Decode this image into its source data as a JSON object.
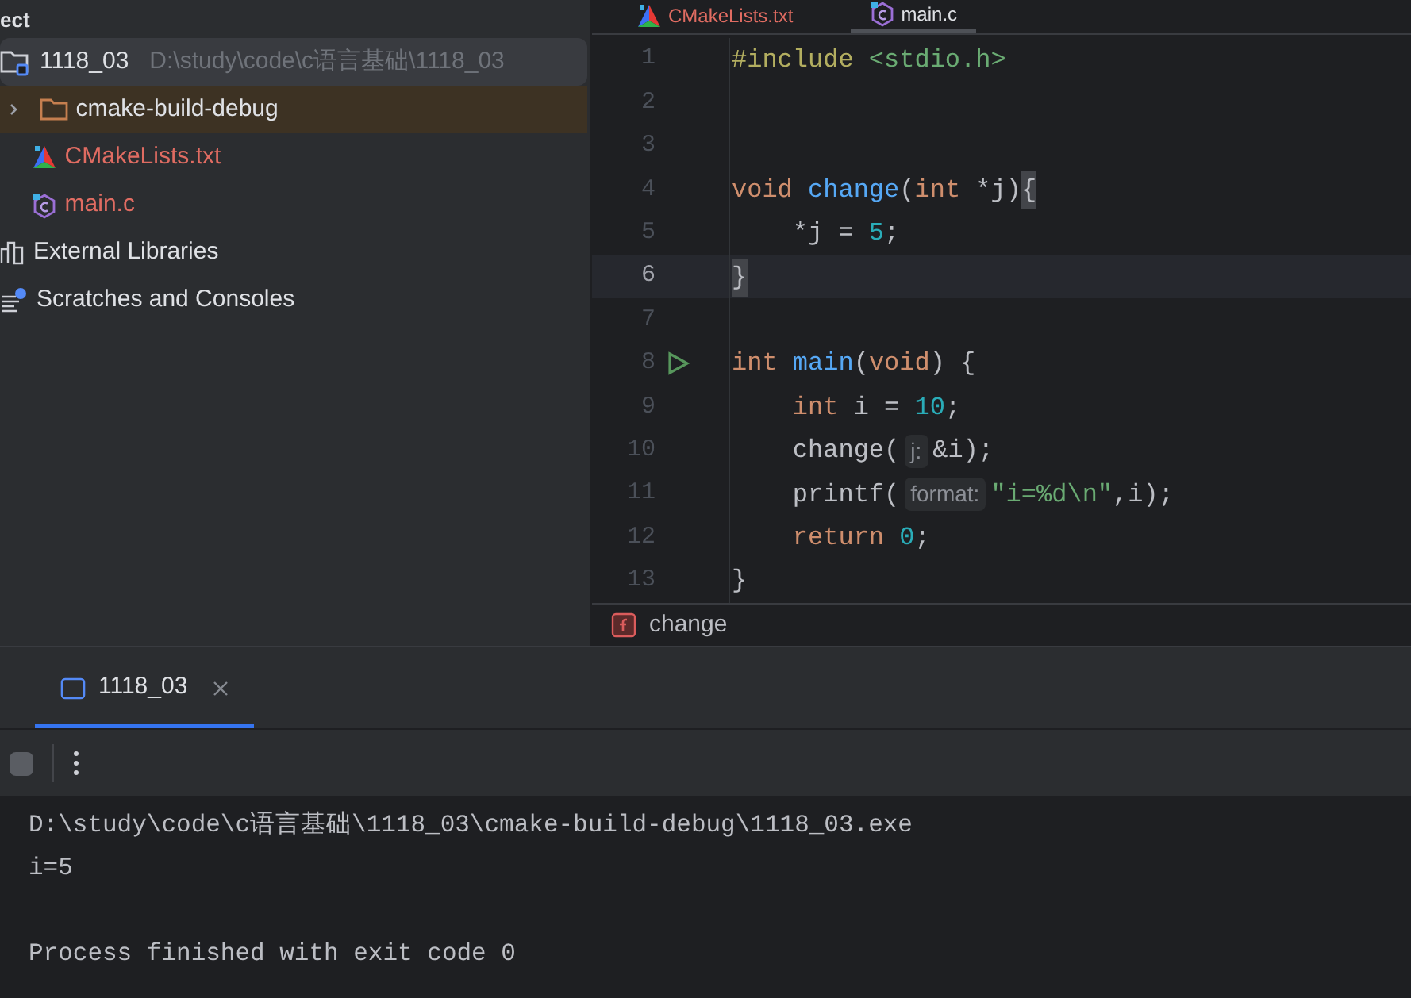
{
  "project_panel": {
    "title": "ect",
    "tree": [
      {
        "name": "1118_03",
        "path": "D:\\study\\code\\c语言基础\\1118_03",
        "kind": "project",
        "selected": true,
        "children": [
          {
            "name": "cmake-build-debug",
            "kind": "excluded_folder",
            "expanded": false,
            "selected": false,
            "untracked": false
          },
          {
            "name": "CMakeLists.txt",
            "kind": "cmake",
            "selected": false,
            "untracked": true
          },
          {
            "name": "main.c",
            "kind": "c",
            "selected": false,
            "untracked": true
          }
        ]
      },
      {
        "name": "External Libraries",
        "kind": "libraries",
        "selected": false
      },
      {
        "name": "Scratches and Consoles",
        "kind": "scratches",
        "selected": false
      }
    ]
  },
  "editor": {
    "tabs": [
      {
        "label": "CMakeLists.txt",
        "kind": "cmake",
        "selected": false
      },
      {
        "label": "main.c",
        "kind": "c",
        "selected": true
      }
    ],
    "lines": [
      {
        "number": "1",
        "current": false,
        "run_marker": false,
        "tokens": [
          {
            "text": "#include",
            "kind": "macro"
          },
          {
            "text": " <stdio.h>",
            "kind": "string"
          }
        ]
      },
      {
        "number": "2",
        "current": false,
        "run_marker": false
      },
      {
        "number": "3",
        "current": false,
        "run_marker": false
      },
      {
        "number": "4",
        "current": false,
        "run_marker": false,
        "tokens": [
          {
            "text": "void",
            "kind": "keyword"
          },
          {
            "text": " change",
            "kind": "function"
          },
          {
            "text": "(",
            "kind": "plain"
          },
          {
            "text": "int",
            "kind": "keyword"
          },
          {
            "text": " *j)",
            "kind": "plain"
          },
          {
            "text": "{",
            "kind": "brace_match"
          }
        ]
      },
      {
        "number": "5",
        "current": false,
        "run_marker": false,
        "tokens": [
          {
            "text": "    *j = ",
            "kind": "plain"
          },
          {
            "text": "5",
            "kind": "number"
          },
          {
            "text": ";",
            "kind": "plain"
          }
        ]
      },
      {
        "number": "6",
        "current": true,
        "run_marker": false,
        "tokens": [
          {
            "text": "}",
            "kind": "brace_match"
          }
        ]
      },
      {
        "number": "7",
        "current": false,
        "run_marker": false
      },
      {
        "number": "8",
        "current": false,
        "run_marker": true,
        "tokens": [
          {
            "text": "int",
            "kind": "keyword"
          },
          {
            "text": " main",
            "kind": "function"
          },
          {
            "text": "(",
            "kind": "plain"
          },
          {
            "text": "void",
            "kind": "keyword"
          },
          {
            "text": ") {",
            "kind": "plain"
          }
        ]
      },
      {
        "number": "9",
        "current": false,
        "run_marker": false,
        "tokens": [
          {
            "text": "    int",
            "kind": "keyword"
          },
          {
            "text": " i = ",
            "kind": "plain"
          },
          {
            "text": "10",
            "kind": "number"
          },
          {
            "text": ";",
            "kind": "plain"
          }
        ]
      },
      {
        "number": "10",
        "current": false,
        "run_marker": false,
        "tokens": [
          {
            "text": "    change(",
            "kind": "plain"
          },
          {
            "text": "j:",
            "kind": "hint"
          },
          {
            "text": "&i);",
            "kind": "plain"
          }
        ]
      },
      {
        "number": "11",
        "current": false,
        "run_marker": false,
        "tokens": [
          {
            "text": "    printf(",
            "kind": "plain"
          },
          {
            "text": "format:",
            "kind": "hint"
          },
          {
            "text": "\"i=%d\\n\"",
            "kind": "string"
          },
          {
            "text": ",i);",
            "kind": "plain"
          }
        ]
      },
      {
        "number": "12",
        "current": false,
        "run_marker": false,
        "tokens": [
          {
            "text": "    return",
            "kind": "keyword"
          },
          {
            "text": " 0",
            "kind": "number"
          },
          {
            "text": ";",
            "kind": "plain"
          }
        ]
      },
      {
        "number": "13",
        "current": false,
        "run_marker": false,
        "tokens": [
          {
            "text": "}",
            "kind": "plain"
          }
        ]
      }
    ],
    "breadcrumb": {
      "kind": "function",
      "label": "change"
    }
  },
  "run_panel": {
    "tabs": [
      {
        "label": "1118_03",
        "selected": true
      }
    ],
    "stop_disabled": true,
    "output": [
      "D:\\study\\code\\c语言基础\\1118_03\\cmake-build-debug\\1118_03.exe",
      "i=5"
    ],
    "exit_message": "Process finished with exit code 0"
  }
}
